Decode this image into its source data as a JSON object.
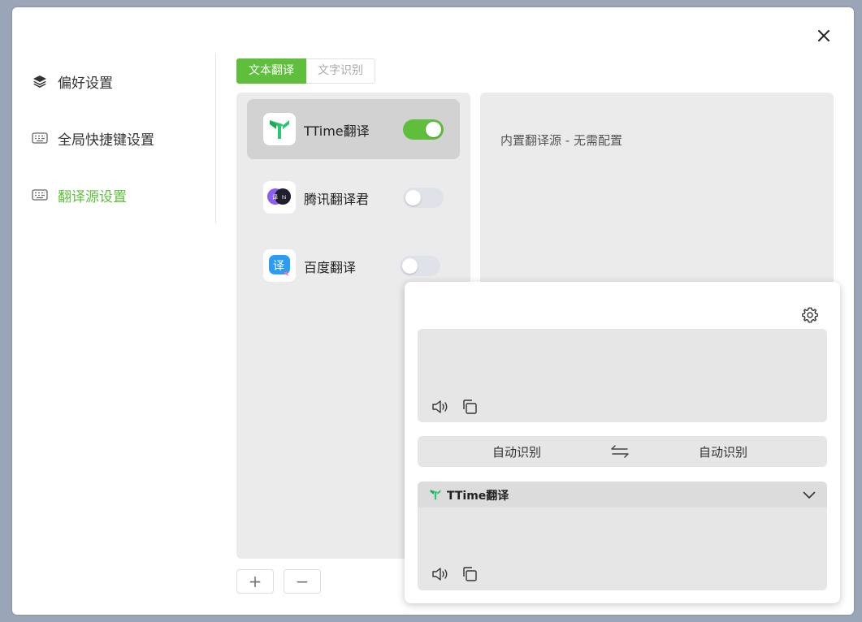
{
  "sidebar": {
    "items": [
      {
        "label": "偏好设置",
        "icon": "layers-icon"
      },
      {
        "label": "全局快捷键设置",
        "icon": "keyboard-icon"
      },
      {
        "label": "翻译源设置",
        "icon": "keyboard-icon",
        "active": true
      }
    ]
  },
  "tabs": [
    {
      "label": "文本翻译",
      "active": true
    },
    {
      "label": "文字识别",
      "active": false
    }
  ],
  "sources": [
    {
      "name": "TTime翻译",
      "enabled": true,
      "selected": true
    },
    {
      "name": "腾讯翻译君",
      "enabled": false
    },
    {
      "name": "百度翻译",
      "enabled": false
    }
  ],
  "buttons": {
    "add": "+",
    "remove": "−"
  },
  "config": {
    "message": "内置翻译源 - 无需配置"
  },
  "translator": {
    "source_lang": "自动识别",
    "target_lang": "自动识别",
    "result_source_name": "TTime翻译"
  },
  "colors": {
    "accent": "#5fbf3c",
    "panel_bg": "#ebebeb"
  }
}
